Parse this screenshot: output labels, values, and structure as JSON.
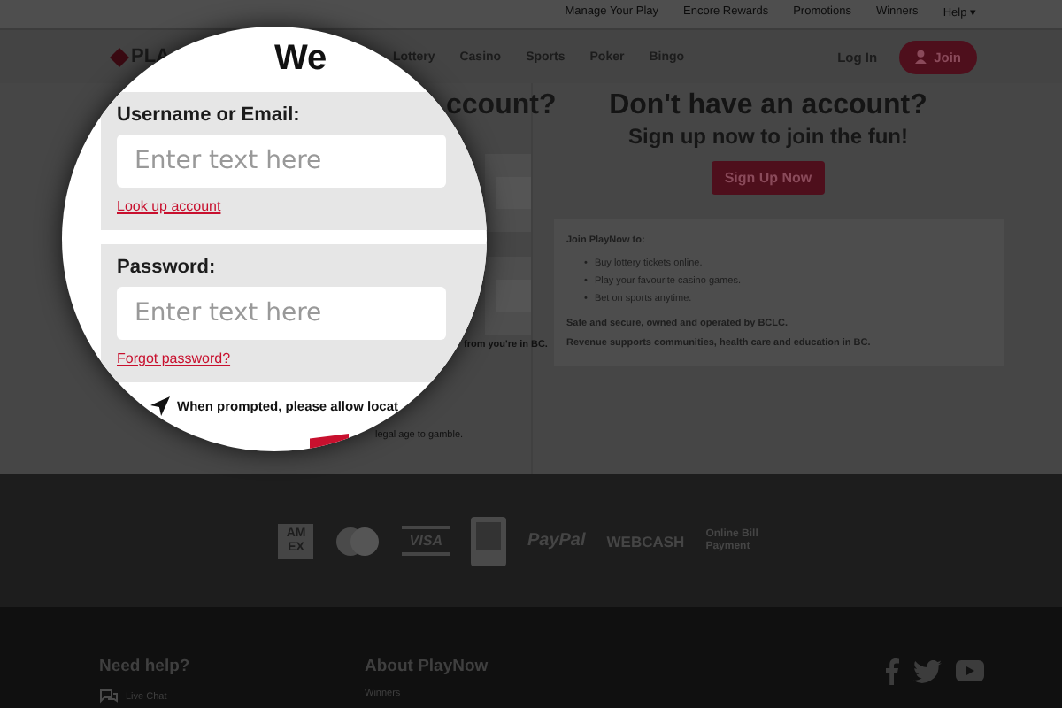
{
  "utility_links": [
    "Manage Your Play",
    "Encore Rewards",
    "Promotions",
    "Winners",
    "Help ▾"
  ],
  "logo": {
    "text": "PLA"
  },
  "nav": [
    "Lottery",
    "Casino",
    "Sports",
    "Poker",
    "Bingo"
  ],
  "login": "Log In",
  "join": "Join",
  "login_column": {
    "heading": "ccount?",
    "location_note": "from you're in BC.",
    "age_note": "legal age to gamble."
  },
  "signup": {
    "heading": "Don't have an account?",
    "subheading": "Sign up now to join the fun!",
    "button": "Sign Up Now",
    "info": {
      "title": "Join PlayNow to:",
      "bullet": "•",
      "bullets": [
        "Buy lottery tickets online.",
        "Play your favourite casino games.",
        "Bet on sports anytime."
      ],
      "lines": [
        "Safe and secure, owned and operated by BCLC.",
        "Revenue supports communities, health care and education in BC."
      ]
    }
  },
  "payments": [
    {
      "kind": "amex",
      "label": "AM EX"
    },
    {
      "kind": "mastercard"
    },
    {
      "kind": "visa",
      "label": "VISA"
    },
    {
      "kind": "interac"
    },
    {
      "kind": "paypal",
      "label": "PayPal"
    },
    {
      "kind": "webcash",
      "label": "WEBCASH"
    },
    {
      "kind": "bill",
      "label": "Online Bill Payment"
    }
  ],
  "footer": {
    "help_title": "Need help?",
    "live_chat": "Live Chat",
    "about_title": "About PlayNow",
    "winners": "Winners"
  },
  "magnifier": {
    "heading": "We",
    "fields": [
      {
        "label": "Username or Email:",
        "placeholder": "Enter text here",
        "link": "Look up account"
      },
      {
        "label": "Password:",
        "placeholder": "Enter text here",
        "link": "Forgot password?"
      }
    ],
    "location_note": "When prompted, please allow locat"
  }
}
